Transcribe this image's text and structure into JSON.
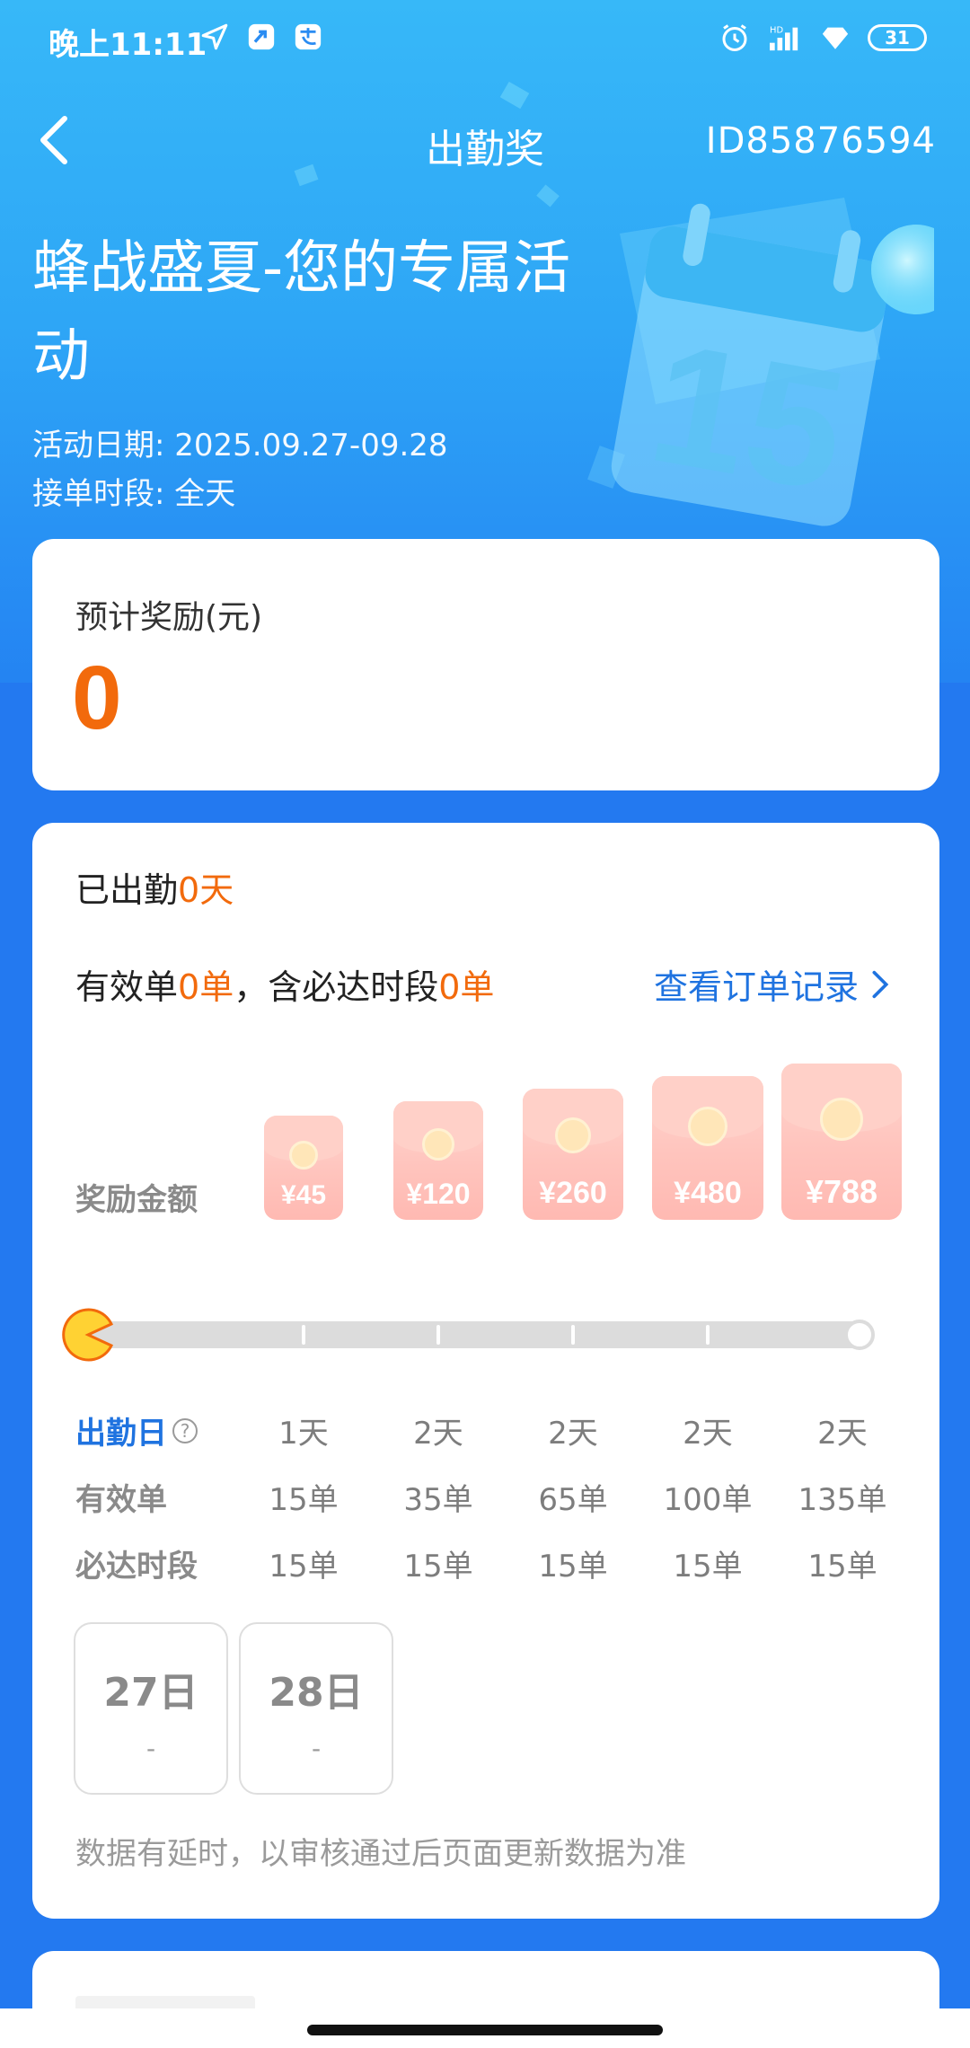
{
  "status_bar": {
    "time": "晚上11:11",
    "battery": "31"
  },
  "nav": {
    "title": "出勤奖",
    "id": "ID85876594"
  },
  "hero": {
    "title": "蜂战盛夏-您的专属活动",
    "date": "活动日期: 2025.09.27-09.28",
    "period": "接单时段: 全天"
  },
  "estimate": {
    "label": "预计奖励(元)",
    "value": "0"
  },
  "attendance": {
    "prefix": "已出勤",
    "value": "0天"
  },
  "valid_orders": {
    "prefix": "有效单",
    "count": "0单",
    "middle": "，含必达时段",
    "must_count": "0单",
    "link": "查看订单记录"
  },
  "rewards": {
    "label": "奖励金额",
    "amounts": [
      "¥45",
      "¥120",
      "¥260",
      "¥480",
      "¥788"
    ]
  },
  "progress": {
    "current_fraction": 0
  },
  "table": {
    "attend_label": "出勤日",
    "valid_label": "有效单",
    "must_label": "必达时段",
    "attend_days": [
      "1天",
      "2天",
      "2天",
      "2天",
      "2天"
    ],
    "valid_orders": [
      "15单",
      "35单",
      "65单",
      "100单",
      "135单"
    ],
    "must_orders": [
      "15单",
      "15单",
      "15单",
      "15单",
      "15单"
    ]
  },
  "days": [
    {
      "date": "27日",
      "value": "-"
    },
    {
      "date": "28日",
      "value": "-"
    }
  ],
  "note": "数据有延时，以审核通过后页面更新数据为准",
  "colors": {
    "accent_blue": "#1f73e0",
    "orange": "#f26a0c",
    "bg_blue": "#2379f0"
  },
  "icons": [
    "back-arrow-icon",
    "location-arrow-icon",
    "app-notify-icon",
    "alipay-icon",
    "alarm-icon",
    "signal-icon",
    "diamond-icon",
    "battery-icon",
    "chevron-right-icon",
    "help-icon",
    "pacman-marker-icon",
    "calendar-illustration"
  ]
}
